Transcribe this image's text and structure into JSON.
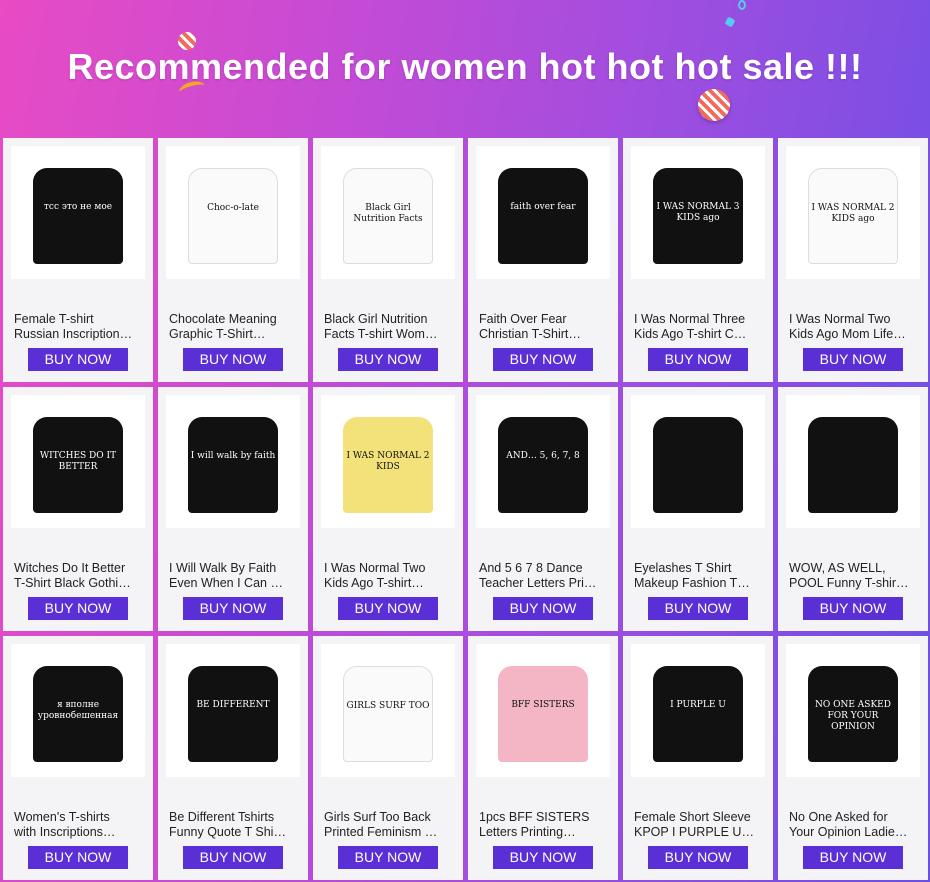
{
  "banner": {
    "title": "Recommended for women hot hot hot sale !!!"
  },
  "buy_label": "BUY NOW",
  "products": [
    {
      "line1": "Female T-shirt",
      "line2": "Russian Inscription…",
      "shirt": "black",
      "print": "тсс это не мое"
    },
    {
      "line1": "Chocolate Meaning",
      "line2": "Graphic T-Shirt…",
      "shirt": "white",
      "print": "Choc-o-late"
    },
    {
      "line1": "Black Girl Nutrition",
      "line2": "Facts T-shirt Wom…",
      "shirt": "white",
      "print": "Black Girl Nutrition Facts"
    },
    {
      "line1": "Faith Over Fear",
      "line2": "Christian T-Shirt…",
      "shirt": "black",
      "print": "faith over fear"
    },
    {
      "line1": "I Was Normal Three",
      "line2": "Kids Ago T-shirt C…",
      "shirt": "black",
      "print": "I WAS NORMAL 3 KIDS ago"
    },
    {
      "line1": "I Was Normal Two",
      "line2": "Kids Ago Mom Life…",
      "shirt": "white",
      "print": "I WAS NORMAL 2 KIDS ago"
    },
    {
      "line1": "Witches Do It Better",
      "line2": "T-Shirt Black Gothi…",
      "shirt": "black",
      "print": "WITCHES DO IT BETTER"
    },
    {
      "line1": "I Will Walk By Faith",
      "line2": "Even When I Can …",
      "shirt": "black",
      "print": "I will walk by faith"
    },
    {
      "line1": "I Was Normal Two",
      "line2": "Kids Ago T-shirt…",
      "shirt": "yellow",
      "print": "I WAS NORMAL 2 KIDS"
    },
    {
      "line1": "And 5 6 7 8 Dance",
      "line2": "Teacher Letters Pri…",
      "shirt": "black",
      "print": "AND… 5, 6, 7, 8"
    },
    {
      "line1": "Eyelashes T Shirt",
      "line2": "Makeup Fashion T…",
      "shirt": "black",
      "print": ""
    },
    {
      "line1": "WOW, AS WELL,",
      "line2": "POOL Funny T-shir…",
      "shirt": "black",
      "print": ""
    },
    {
      "line1": "Women's T-shirts",
      "line2": "with Inscriptions…",
      "shirt": "black",
      "print": "я вполне уровнобешенная"
    },
    {
      "line1": "Be Different Tshirts",
      "line2": "Funny Quote T Shi…",
      "shirt": "black",
      "print": "BE DIFFERENT"
    },
    {
      "line1": "Girls Surf Too Back",
      "line2": "Printed Feminism …",
      "shirt": "white",
      "print": "GIRLS SURF TOO"
    },
    {
      "line1": "1pcs BFF SISTERS",
      "line2": "Letters Printing…",
      "shirt": "pink",
      "print": "BFF SISTERS"
    },
    {
      "line1": "Female Short Sleeve",
      "line2": "KPOP I PURPLE U…",
      "shirt": "black",
      "print": "I PURPLE U"
    },
    {
      "line1": "No One Asked for",
      "line2": "Your Opinion Ladie…",
      "shirt": "black",
      "print": "NO ONE ASKED FOR YOUR OPINION"
    }
  ],
  "colors": {
    "button": "#5a2fd6",
    "card": "#f4f4f6",
    "banner_text": "#ffffff"
  }
}
